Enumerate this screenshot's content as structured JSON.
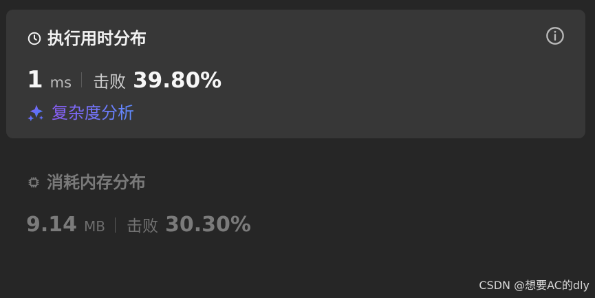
{
  "runtime": {
    "title": "执行用时分布",
    "value": "1",
    "unit": "ms",
    "beat_label": "击败",
    "beat_value": "39.80%",
    "complexity_label": "复杂度分析",
    "icons": {
      "title": "clock-icon",
      "info": "info-icon",
      "complexity": "sparkle-icon"
    },
    "colors": {
      "card_bg": "#373737",
      "title": "#f2f2f2",
      "link_start": "#8a5cf6",
      "link_end": "#5f8cff"
    }
  },
  "memory": {
    "title": "消耗内存分布",
    "value": "9.14",
    "unit": "MB",
    "beat_label": "击败",
    "beat_value": "30.30%",
    "icons": {
      "title": "chip-icon"
    },
    "colors": {
      "text": "#7b7b7b"
    }
  },
  "watermark": {
    "text": "CSDN @想要AC的dly"
  }
}
